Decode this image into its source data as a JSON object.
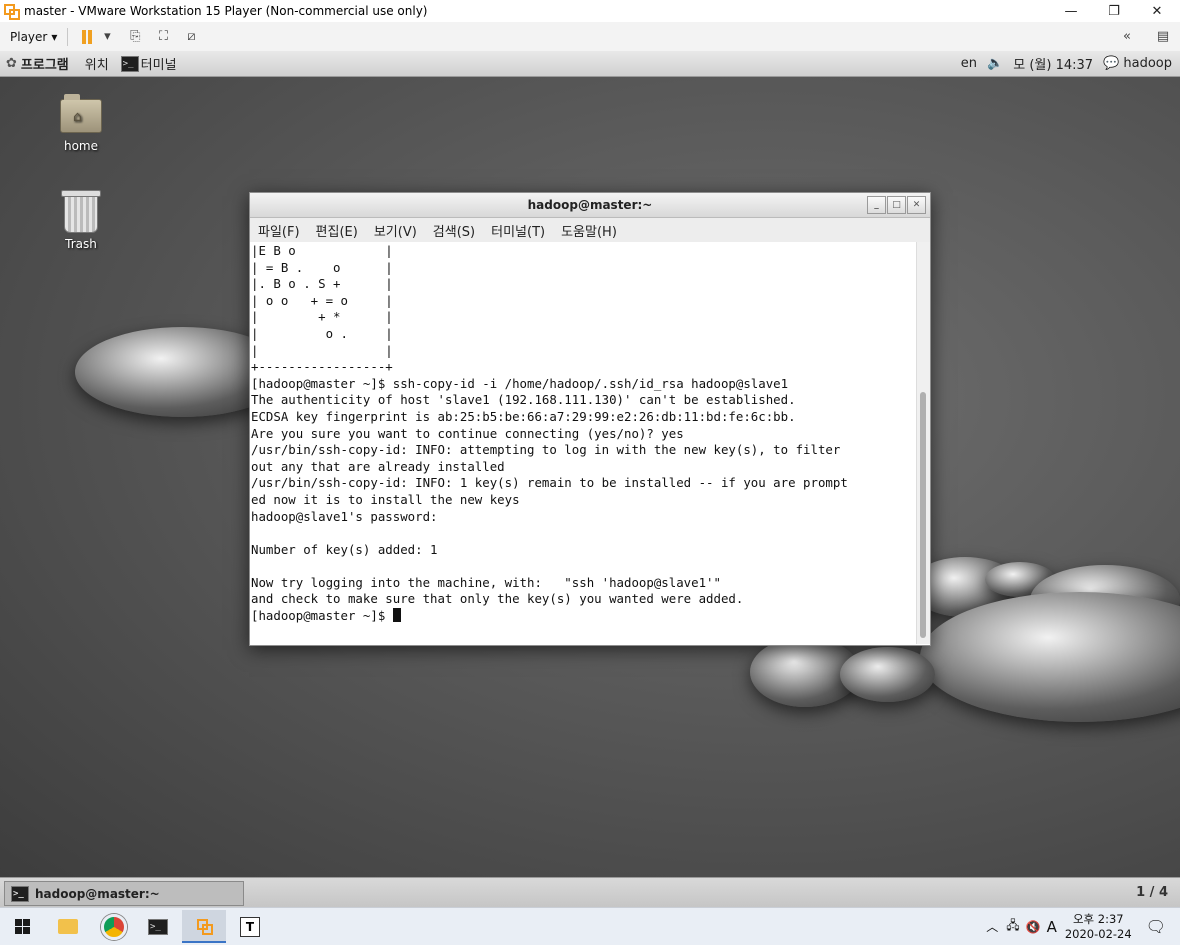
{
  "vmware": {
    "title": "master - VMware Workstation 15 Player (Non-commercial use only)",
    "player_menu": "Player",
    "window_controls": [
      "—",
      "❐",
      "✕"
    ]
  },
  "guest_panel": {
    "applications": "프로그램",
    "places": "위치",
    "terminal_launcher": "터미널",
    "lang": "en",
    "clock": "월) 14:37",
    "clock_prefix": "모 (",
    "user": "hadoop"
  },
  "desktop": {
    "icons": [
      {
        "label": "home"
      },
      {
        "label": "Trash"
      }
    ]
  },
  "terminal": {
    "title": "hadoop@master:~",
    "menu": [
      "파일(F)",
      "편집(E)",
      "보기(V)",
      "검색(S)",
      "터미널(T)",
      "도움말(H)"
    ],
    "lines": [
      "|E B o            |",
      "| = B .    o      |",
      "|. B o . S +      |",
      "| o o   + = o     |",
      "|        + *      |",
      "|         o .     |",
      "|                 |",
      "+-----------------+",
      "[hadoop@master ~]$ ssh-copy-id -i /home/hadoop/.ssh/id_rsa hadoop@slave1",
      "The authenticity of host 'slave1 (192.168.111.130)' can't be established.",
      "ECDSA key fingerprint is ab:25:b5:be:66:a7:29:99:e2:26:db:11:bd:fe:6c:bb.",
      "Are you sure you want to continue connecting (yes/no)? yes",
      "/usr/bin/ssh-copy-id: INFO: attempting to log in with the new key(s), to filter",
      "out any that are already installed",
      "/usr/bin/ssh-copy-id: INFO: 1 key(s) remain to be installed -- if you are prompt",
      "ed now it is to install the new keys",
      "hadoop@slave1's password:",
      "",
      "Number of key(s) added: 1",
      "",
      "Now try logging into the machine, with:   \"ssh 'hadoop@slave1'\"",
      "and check to make sure that only the key(s) you wanted were added.",
      ""
    ],
    "prompt": "[hadoop@master ~]$ "
  },
  "bottom_panel": {
    "task": "hadoop@master:~",
    "pager": "1 / 4"
  },
  "windows_taskbar": {
    "ime": "A",
    "time": "오후 2:37",
    "date": "2020-02-24"
  }
}
